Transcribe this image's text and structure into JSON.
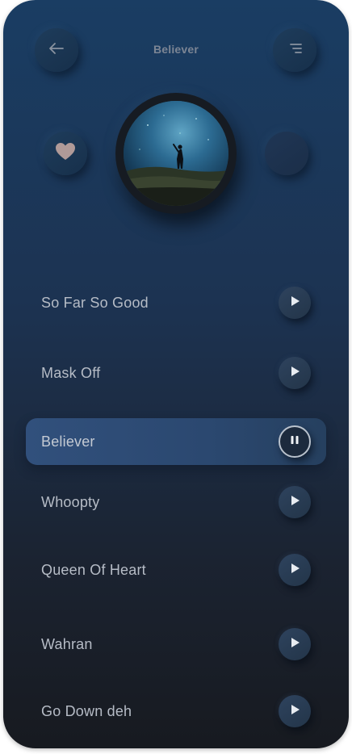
{
  "header": {
    "title": "Believer",
    "back_icon": "arrow-left-icon",
    "menu_icon": "menu-lines-icon"
  },
  "player": {
    "like_icon": "heart-icon",
    "album_art": "night-sky-album-art"
  },
  "tracks": [
    {
      "name": "So Far So Good",
      "state": "play"
    },
    {
      "name": "Mask Off",
      "state": "play"
    },
    {
      "name": "Believer",
      "state": "pause"
    },
    {
      "name": "Whoopty",
      "state": "play"
    },
    {
      "name": "Queen Of Heart",
      "state": "play"
    },
    {
      "name": "Wahran",
      "state": "play"
    },
    {
      "name": "Go Down deh",
      "state": "play"
    }
  ],
  "colors": {
    "background_top": "#1a3d63",
    "background_bottom": "#171a20",
    "active_row": "#31507c",
    "text": "#b6bcc6",
    "title": "#7b8594",
    "heart": "#b09a98"
  }
}
